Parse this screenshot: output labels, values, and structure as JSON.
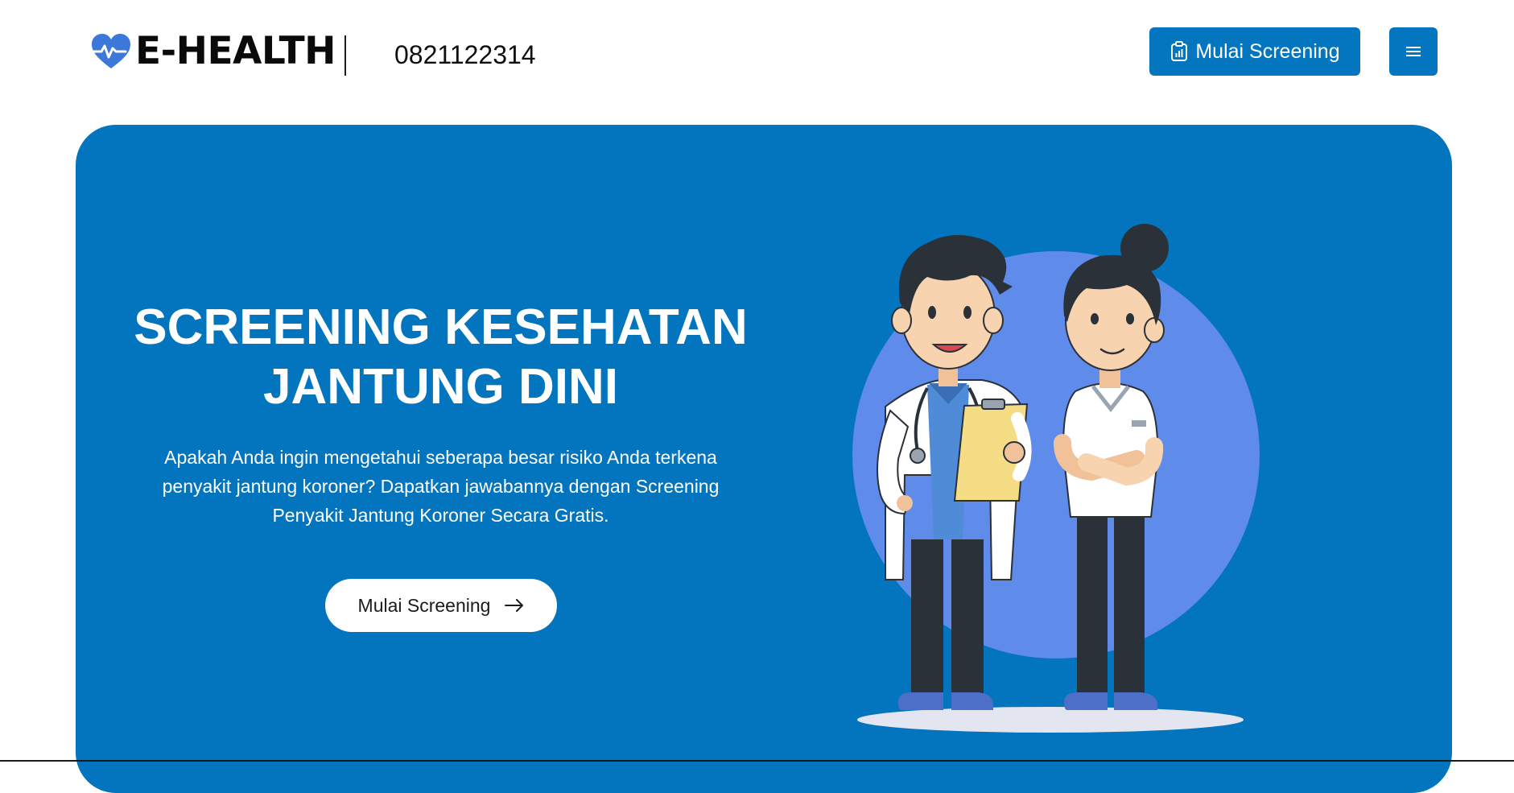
{
  "header": {
    "brand": "E-HEALTH",
    "phone": "0821122314",
    "cta_label": "Mulai Screening",
    "logo_icon": "heart-pulse-icon",
    "cta_icon": "clipboard-chart-icon",
    "menu_icon": "hamburger-menu-icon"
  },
  "hero": {
    "title_line1": "SCREENING KESEHATAN",
    "title_line2": "JANTUNG DINI",
    "description": "Apakah Anda ingin mengetahui seberapa besar risiko Anda terkena penyakit jantung koroner? Dapatkan jawabannya dengan Screening Penyakit Jantung Koroner Secara Gratis.",
    "cta_label": "Mulai Screening",
    "cta_icon": "arrow-right-icon"
  },
  "colors": {
    "primary": "#0374be",
    "button": "#0376bf",
    "circle": "#5f8bea",
    "text_dark": "#0a0a0a"
  }
}
